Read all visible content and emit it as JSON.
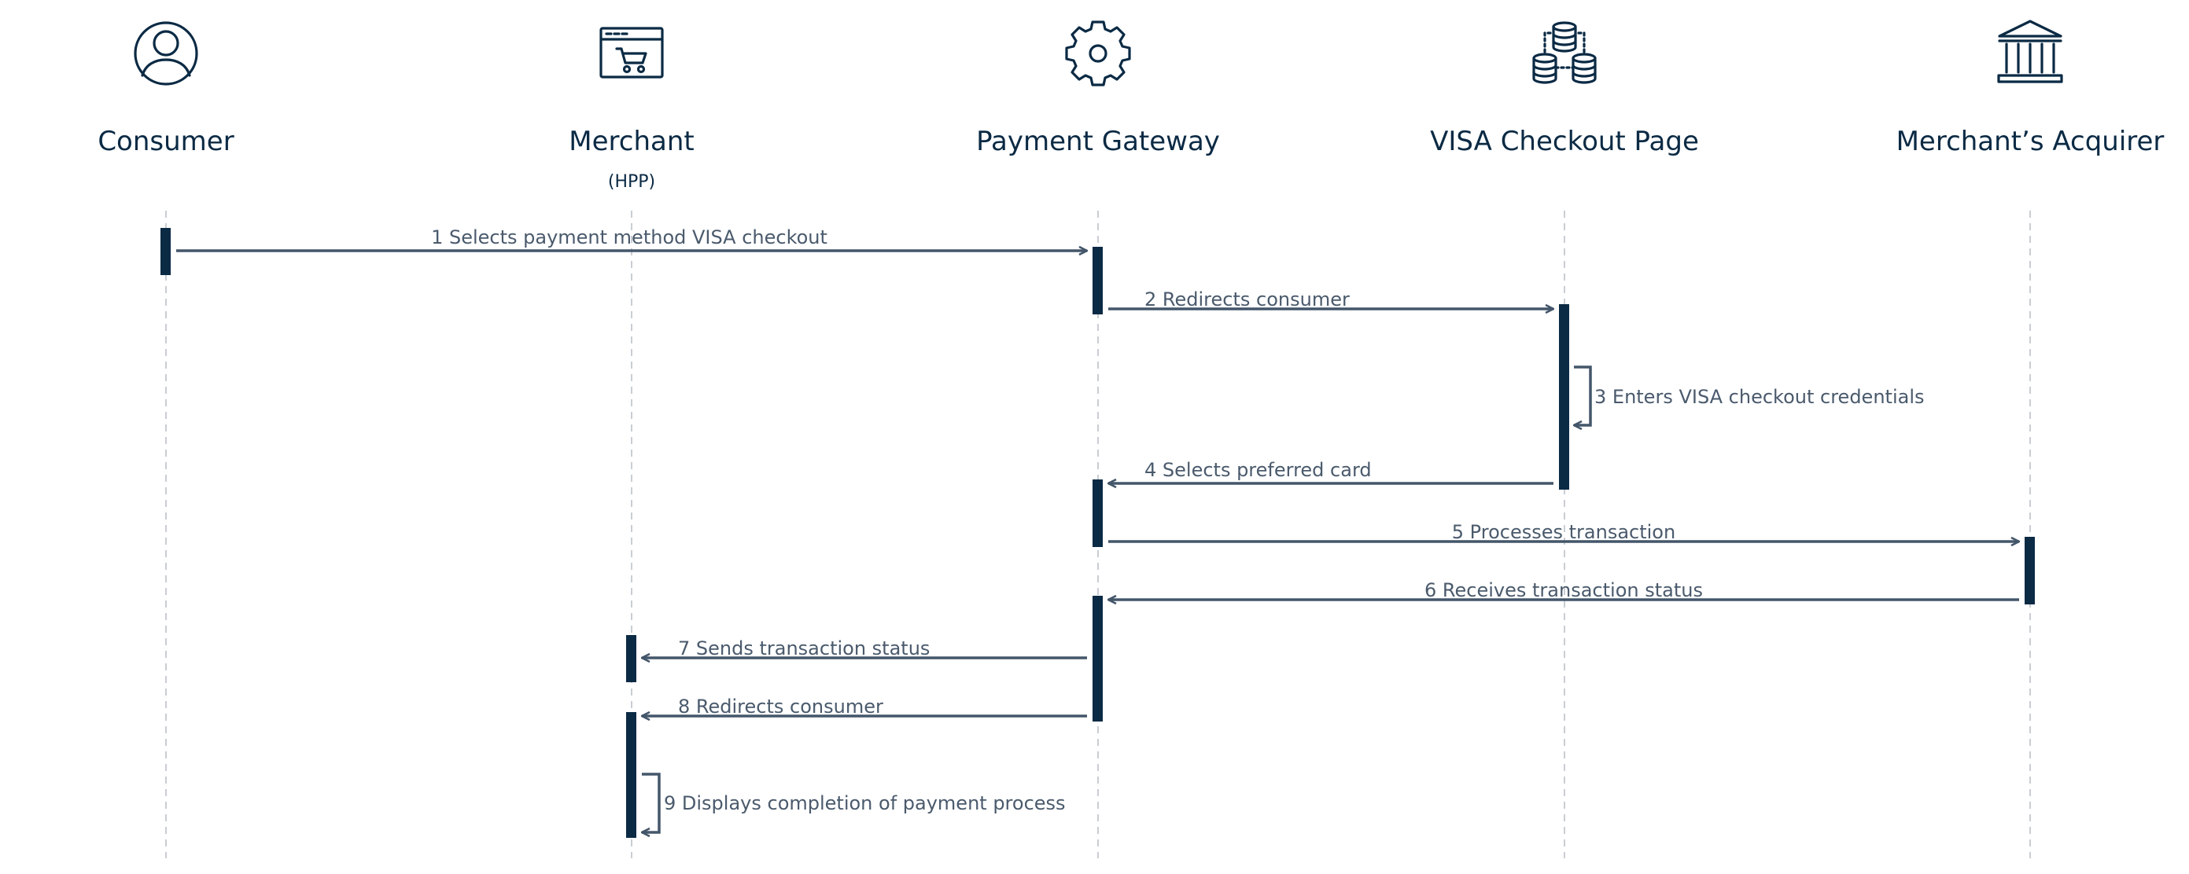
{
  "actors": [
    {
      "id": "consumer",
      "title": "Consumer",
      "subtitle": "",
      "icon": "user-icon"
    },
    {
      "id": "merchant",
      "title": "Merchant",
      "subtitle": "(HPP)",
      "icon": "shopping-cart-browser-icon"
    },
    {
      "id": "gateway",
      "title": "Payment Gateway",
      "subtitle": "",
      "icon": "gear-icon"
    },
    {
      "id": "visa",
      "title": "VISA Checkout Page",
      "subtitle": "",
      "icon": "database-network-icon"
    },
    {
      "id": "acquirer",
      "title": "Merchant’s Acquirer",
      "subtitle": "",
      "icon": "bank-icon"
    }
  ],
  "messages": [
    {
      "label": "1 Selects payment method VISA checkout",
      "from": "consumer",
      "to": "gateway"
    },
    {
      "label": "2 Redirects consumer",
      "from": "gateway",
      "to": "visa"
    },
    {
      "label": "3 Enters VISA checkout credentials",
      "from": "visa",
      "to": "visa"
    },
    {
      "label": "4 Selects preferred card",
      "from": "visa",
      "to": "gateway"
    },
    {
      "label": "5 Processes transaction",
      "from": "gateway",
      "to": "acquirer"
    },
    {
      "label": "6 Receives transaction status",
      "from": "acquirer",
      "to": "gateway"
    },
    {
      "label": "7 Sends transaction status",
      "from": "gateway",
      "to": "merchant"
    },
    {
      "label": "8 Redirects consumer",
      "from": "gateway",
      "to": "merchant"
    },
    {
      "label": "9 Displays completion of payment process",
      "from": "merchant",
      "to": "merchant"
    }
  ],
  "colors": {
    "primary": "#0b2a44",
    "arrow": "#44566a",
    "label": "#4a5a6c",
    "lifeline": "#c9ced4"
  }
}
